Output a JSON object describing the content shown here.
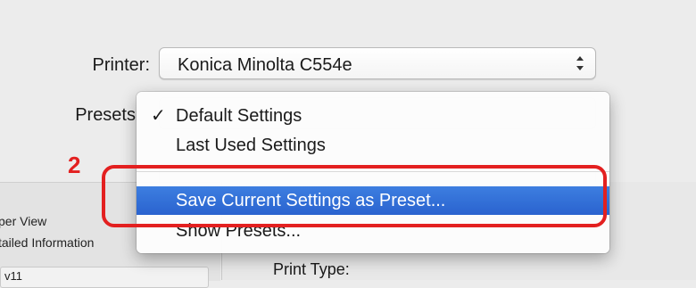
{
  "dialog": {
    "printer_label": "Printer:",
    "printer_value": "Konica Minolta C554e",
    "presets_label": "Presets"
  },
  "presets_menu": {
    "items": [
      {
        "label": "Default Settings",
        "checked": true
      },
      {
        "label": "Last Used Settings",
        "checked": false
      },
      {
        "label": "Save Current Settings as Preset...",
        "highlighted": true
      },
      {
        "label": "Show Presets..."
      }
    ],
    "check_glyph": "✓"
  },
  "sidebar": {
    "item1": "per View",
    "item2": "tailed Information",
    "item3": "v11"
  },
  "right_panel": {
    "print_type_label": "Print Type:"
  },
  "annotation": {
    "step_number": "2",
    "color": "#e32020"
  }
}
